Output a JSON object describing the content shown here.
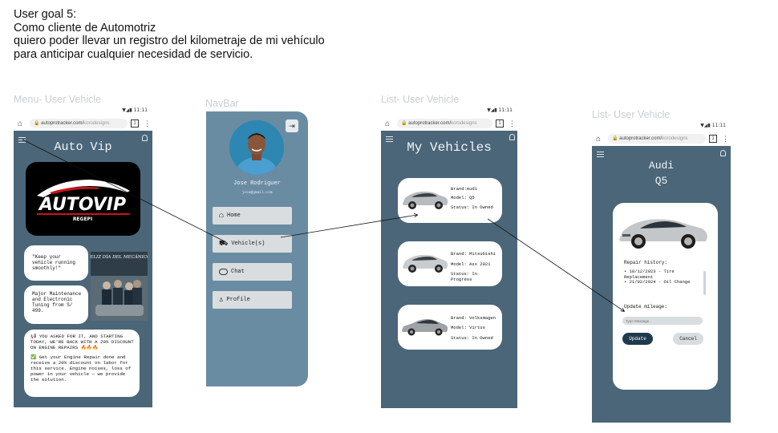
{
  "user_goal": {
    "lines": [
      "User goal 5:",
      "Como cliente de Automotriz",
      "quiero poder llevar un registro del kilometraje de mi vehículo",
      "para anticipar cualquier necesidad de servicio."
    ]
  },
  "frames": {
    "menu_label": "Menu- User Vehicle",
    "navbar_label": "NavBar",
    "list_label": "List- User Vehicle",
    "detail_label": "List- User Vehicle"
  },
  "browser": {
    "status_time": "11:11",
    "url": "autoprotracker.com/",
    "url_path": "korodesigns",
    "tab_count": "1"
  },
  "menu_screen": {
    "title": "Auto Vip",
    "logo_text": "AUTOVIP",
    "logo_sub": "REGEPI",
    "quote": "\"Keep your vehicle running smoothly!\"",
    "promo": "Major Maintenance and Electronic Tuning from S/ 499.",
    "poster_caption": "FELIZ DÍA DEL MECÁNICO",
    "announcement_1": "📢 YOU ASKED FOR IT, AND STARTING TODAY, WE'RE BACK WITH A 20% DISCOUNT ON ENGINE REPAIRS 🔥🔥🔥",
    "announcement_2": "✅ Get your Engine Repair done and receive a 20% discount on labor for this service. Engine noises, loss of power in your vehicle — we provide the solution."
  },
  "navbar": {
    "user_name": "Jose Rodriguer",
    "user_email": "jose@gmail.com",
    "items": [
      {
        "label": "Home",
        "icon": "home-icon"
      },
      {
        "label": "Vehicle(s)",
        "icon": "car-icon"
      },
      {
        "label": "Chat",
        "icon": "chat-icon"
      },
      {
        "label": "Profile",
        "icon": "profile-icon"
      }
    ]
  },
  "list_screen": {
    "title": "My Vehicles",
    "vehicles": [
      {
        "brand": "Brand:Audi",
        "model": "Model: Q5",
        "status": "Status: In Owned"
      },
      {
        "brand": "Brand: Mitsubishi",
        "model": "Model: Asx 2021",
        "status": "Status: In Progress"
      },
      {
        "brand": "Brand: Volksmagen",
        "model": "Model: Virtus",
        "status": "Status: In Owned"
      }
    ]
  },
  "detail_screen": {
    "title_line1": "Audi",
    "title_line2": "Q5",
    "repair_heading": "Repair history:",
    "repairs": [
      "• 18/12/2023 - Tire Replacement",
      "• 21/02/2024 - Oil Change"
    ],
    "mileage_label": "Update mileage:",
    "mileage_placeholder": "Type Message",
    "update_button": "Update",
    "cancel_button": "Cancel"
  },
  "colors": {
    "app_bg": "#4b6678",
    "navbar_bg": "#6a8ca3",
    "primary_button": "#1f3a4d",
    "card_bg": "#ffffff",
    "nav_item_bg": "#d9dde0"
  }
}
